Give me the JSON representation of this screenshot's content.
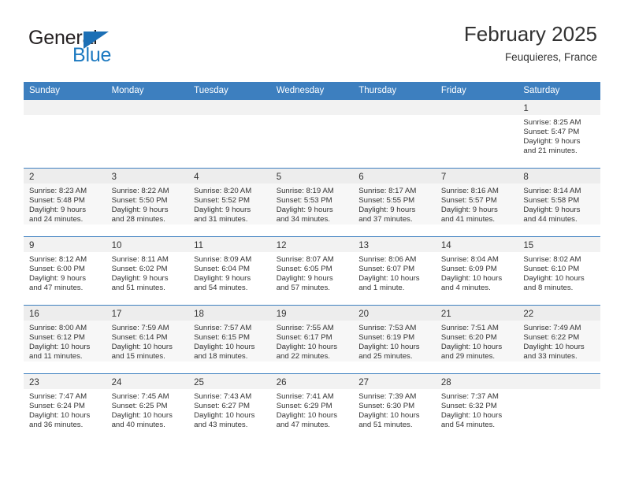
{
  "brand": {
    "name_part1": "General",
    "name_part2": "Blue",
    "accent_color": "#1c79c0"
  },
  "header": {
    "title": "February 2025",
    "subtitle": "Feuquieres, France"
  },
  "calendar": {
    "header_bg": "#3d7fbf",
    "weekday_headers": [
      "Sunday",
      "Monday",
      "Tuesday",
      "Wednesday",
      "Thursday",
      "Friday",
      "Saturday"
    ],
    "weeks": [
      [
        {
          "day": "",
          "sunrise": "",
          "sunset": "",
          "daylight_line1": "",
          "daylight_line2": ""
        },
        {
          "day": "",
          "sunrise": "",
          "sunset": "",
          "daylight_line1": "",
          "daylight_line2": ""
        },
        {
          "day": "",
          "sunrise": "",
          "sunset": "",
          "daylight_line1": "",
          "daylight_line2": ""
        },
        {
          "day": "",
          "sunrise": "",
          "sunset": "",
          "daylight_line1": "",
          "daylight_line2": ""
        },
        {
          "day": "",
          "sunrise": "",
          "sunset": "",
          "daylight_line1": "",
          "daylight_line2": ""
        },
        {
          "day": "",
          "sunrise": "",
          "sunset": "",
          "daylight_line1": "",
          "daylight_line2": ""
        },
        {
          "day": "1",
          "sunrise": "Sunrise: 8:25 AM",
          "sunset": "Sunset: 5:47 PM",
          "daylight_line1": "Daylight: 9 hours",
          "daylight_line2": "and 21 minutes."
        }
      ],
      [
        {
          "day": "2",
          "sunrise": "Sunrise: 8:23 AM",
          "sunset": "Sunset: 5:48 PM",
          "daylight_line1": "Daylight: 9 hours",
          "daylight_line2": "and 24 minutes."
        },
        {
          "day": "3",
          "sunrise": "Sunrise: 8:22 AM",
          "sunset": "Sunset: 5:50 PM",
          "daylight_line1": "Daylight: 9 hours",
          "daylight_line2": "and 28 minutes."
        },
        {
          "day": "4",
          "sunrise": "Sunrise: 8:20 AM",
          "sunset": "Sunset: 5:52 PM",
          "daylight_line1": "Daylight: 9 hours",
          "daylight_line2": "and 31 minutes."
        },
        {
          "day": "5",
          "sunrise": "Sunrise: 8:19 AM",
          "sunset": "Sunset: 5:53 PM",
          "daylight_line1": "Daylight: 9 hours",
          "daylight_line2": "and 34 minutes."
        },
        {
          "day": "6",
          "sunrise": "Sunrise: 8:17 AM",
          "sunset": "Sunset: 5:55 PM",
          "daylight_line1": "Daylight: 9 hours",
          "daylight_line2": "and 37 minutes."
        },
        {
          "day": "7",
          "sunrise": "Sunrise: 8:16 AM",
          "sunset": "Sunset: 5:57 PM",
          "daylight_line1": "Daylight: 9 hours",
          "daylight_line2": "and 41 minutes."
        },
        {
          "day": "8",
          "sunrise": "Sunrise: 8:14 AM",
          "sunset": "Sunset: 5:58 PM",
          "daylight_line1": "Daylight: 9 hours",
          "daylight_line2": "and 44 minutes."
        }
      ],
      [
        {
          "day": "9",
          "sunrise": "Sunrise: 8:12 AM",
          "sunset": "Sunset: 6:00 PM",
          "daylight_line1": "Daylight: 9 hours",
          "daylight_line2": "and 47 minutes."
        },
        {
          "day": "10",
          "sunrise": "Sunrise: 8:11 AM",
          "sunset": "Sunset: 6:02 PM",
          "daylight_line1": "Daylight: 9 hours",
          "daylight_line2": "and 51 minutes."
        },
        {
          "day": "11",
          "sunrise": "Sunrise: 8:09 AM",
          "sunset": "Sunset: 6:04 PM",
          "daylight_line1": "Daylight: 9 hours",
          "daylight_line2": "and 54 minutes."
        },
        {
          "day": "12",
          "sunrise": "Sunrise: 8:07 AM",
          "sunset": "Sunset: 6:05 PM",
          "daylight_line1": "Daylight: 9 hours",
          "daylight_line2": "and 57 minutes."
        },
        {
          "day": "13",
          "sunrise": "Sunrise: 8:06 AM",
          "sunset": "Sunset: 6:07 PM",
          "daylight_line1": "Daylight: 10 hours",
          "daylight_line2": "and 1 minute."
        },
        {
          "day": "14",
          "sunrise": "Sunrise: 8:04 AM",
          "sunset": "Sunset: 6:09 PM",
          "daylight_line1": "Daylight: 10 hours",
          "daylight_line2": "and 4 minutes."
        },
        {
          "day": "15",
          "sunrise": "Sunrise: 8:02 AM",
          "sunset": "Sunset: 6:10 PM",
          "daylight_line1": "Daylight: 10 hours",
          "daylight_line2": "and 8 minutes."
        }
      ],
      [
        {
          "day": "16",
          "sunrise": "Sunrise: 8:00 AM",
          "sunset": "Sunset: 6:12 PM",
          "daylight_line1": "Daylight: 10 hours",
          "daylight_line2": "and 11 minutes."
        },
        {
          "day": "17",
          "sunrise": "Sunrise: 7:59 AM",
          "sunset": "Sunset: 6:14 PM",
          "daylight_line1": "Daylight: 10 hours",
          "daylight_line2": "and 15 minutes."
        },
        {
          "day": "18",
          "sunrise": "Sunrise: 7:57 AM",
          "sunset": "Sunset: 6:15 PM",
          "daylight_line1": "Daylight: 10 hours",
          "daylight_line2": "and 18 minutes."
        },
        {
          "day": "19",
          "sunrise": "Sunrise: 7:55 AM",
          "sunset": "Sunset: 6:17 PM",
          "daylight_line1": "Daylight: 10 hours",
          "daylight_line2": "and 22 minutes."
        },
        {
          "day": "20",
          "sunrise": "Sunrise: 7:53 AM",
          "sunset": "Sunset: 6:19 PM",
          "daylight_line1": "Daylight: 10 hours",
          "daylight_line2": "and 25 minutes."
        },
        {
          "day": "21",
          "sunrise": "Sunrise: 7:51 AM",
          "sunset": "Sunset: 6:20 PM",
          "daylight_line1": "Daylight: 10 hours",
          "daylight_line2": "and 29 minutes."
        },
        {
          "day": "22",
          "sunrise": "Sunrise: 7:49 AM",
          "sunset": "Sunset: 6:22 PM",
          "daylight_line1": "Daylight: 10 hours",
          "daylight_line2": "and 33 minutes."
        }
      ],
      [
        {
          "day": "23",
          "sunrise": "Sunrise: 7:47 AM",
          "sunset": "Sunset: 6:24 PM",
          "daylight_line1": "Daylight: 10 hours",
          "daylight_line2": "and 36 minutes."
        },
        {
          "day": "24",
          "sunrise": "Sunrise: 7:45 AM",
          "sunset": "Sunset: 6:25 PM",
          "daylight_line1": "Daylight: 10 hours",
          "daylight_line2": "and 40 minutes."
        },
        {
          "day": "25",
          "sunrise": "Sunrise: 7:43 AM",
          "sunset": "Sunset: 6:27 PM",
          "daylight_line1": "Daylight: 10 hours",
          "daylight_line2": "and 43 minutes."
        },
        {
          "day": "26",
          "sunrise": "Sunrise: 7:41 AM",
          "sunset": "Sunset: 6:29 PM",
          "daylight_line1": "Daylight: 10 hours",
          "daylight_line2": "and 47 minutes."
        },
        {
          "day": "27",
          "sunrise": "Sunrise: 7:39 AM",
          "sunset": "Sunset: 6:30 PM",
          "daylight_line1": "Daylight: 10 hours",
          "daylight_line2": "and 51 minutes."
        },
        {
          "day": "28",
          "sunrise": "Sunrise: 7:37 AM",
          "sunset": "Sunset: 6:32 PM",
          "daylight_line1": "Daylight: 10 hours",
          "daylight_line2": "and 54 minutes."
        },
        {
          "day": "",
          "sunrise": "",
          "sunset": "",
          "daylight_line1": "",
          "daylight_line2": ""
        }
      ]
    ]
  }
}
